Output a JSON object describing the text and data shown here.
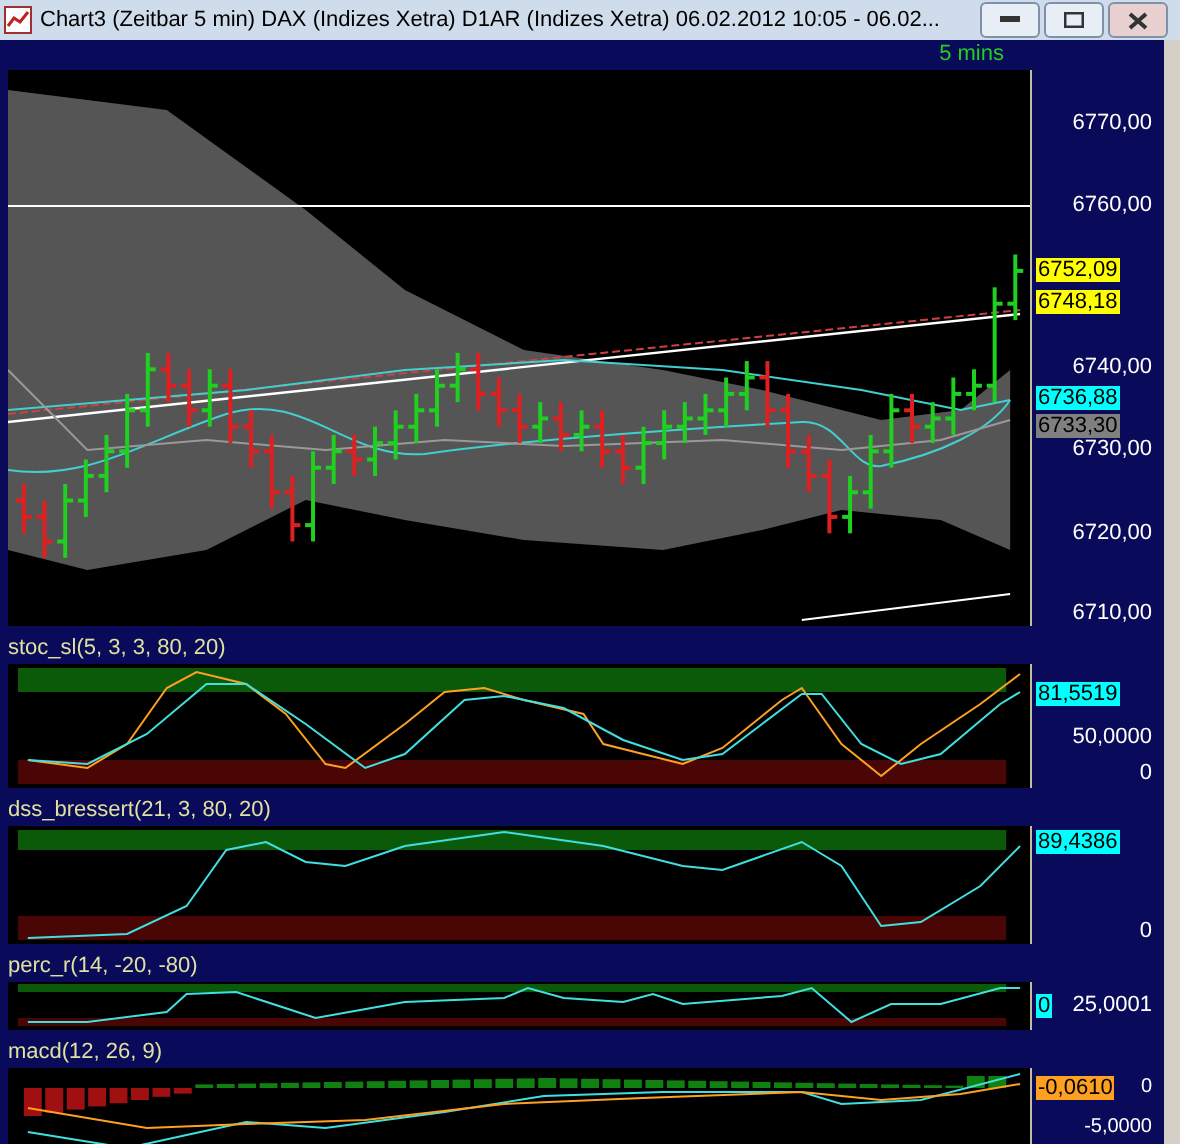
{
  "window": {
    "title": "Chart3 (Zeitbar 5 min)  DAX (Indizes Xetra) D1AR (Indizes Xetra) 06.02.2012 10:05 - 06.02..."
  },
  "timeframe": "5 mins",
  "panels": [
    {
      "kind": "price",
      "axis": [
        "6770,00",
        "6760,00",
        "6740,00",
        "6730,00",
        "6720,00",
        "6710,00"
      ],
      "tags": [
        {
          "text": "6752,09",
          "color": "#ffff00"
        },
        {
          "text": "6748,18",
          "color": "#ffff00"
        },
        {
          "text": "6736,88",
          "color": "#00ffff"
        },
        {
          "text": "6733,30",
          "color": "#808080"
        }
      ]
    },
    {
      "kind": "stoch",
      "title": "stoc_sl(5, 3, 3, 80, 20)",
      "axis": [
        "50,0000",
        "0"
      ],
      "tags": [
        {
          "text": "81,5519",
          "color": "#00ffff"
        }
      ]
    },
    {
      "kind": "dss",
      "title": "dss_bressert(21, 3, 80, 20)",
      "axis": [
        "0"
      ],
      "tags": [
        {
          "text": "89,4386",
          "color": "#00ffff"
        }
      ]
    },
    {
      "kind": "percr",
      "title": "perc_r(14, -20, -80)",
      "axis": [
        "25,0001"
      ],
      "tags": [
        {
          "text": "0",
          "color": "#00ffff"
        }
      ]
    },
    {
      "kind": "macd",
      "title": "macd(12, 26, 9)",
      "axis": [
        "0",
        "-5,0000"
      ],
      "tags": [
        {
          "text": "-0,0610",
          "color": "#ffa020"
        }
      ]
    }
  ]
}
